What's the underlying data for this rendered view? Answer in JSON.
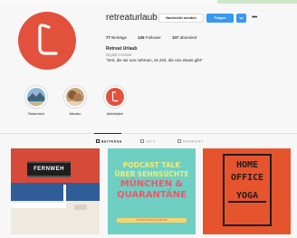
{
  "profile": {
    "username": "retreaturlaub",
    "message_label": "Nachricht senden",
    "follow_label": "Folgen",
    "stats": [
      {
        "value": "77",
        "label": "Beiträge"
      },
      {
        "value": "125",
        "label": "Follower"
      },
      {
        "value": "107",
        "label": "abonniert"
      }
    ],
    "full_name": "Retreat Urlaub",
    "category": "Digital Creator",
    "bio": "\"Zeit, die wir uns nehmen, ist Zeit, die uns etwas gibt\""
  },
  "highlights": [
    {
      "label": "Österreich",
      "icon": "mountain-lake-photo"
    },
    {
      "label": "Mexiko",
      "icon": "beach-photo"
    },
    {
      "label": "Aktivitäten",
      "icon": "logo-icon"
    }
  ],
  "tabs": [
    {
      "label": "BEITRÄGE",
      "active": true
    },
    {
      "label": "IGTV",
      "active": false
    },
    {
      "label": "MARKIERT",
      "active": false
    }
  ],
  "posts": [
    {
      "sign_text": "FERNWEH"
    },
    {
      "line1": "PODCAST TALK",
      "line2": "ÜBER SEHNSÜCHTE",
      "line3": "MÜNCHEN &",
      "line4": "QUARANTÄNE",
      "band": "retreat urlaub-podcast"
    },
    {
      "line1": "HOME",
      "line2": "OFFICE",
      "line3": "YOGA"
    }
  ],
  "colors": {
    "brand_red": "#e2513c",
    "follow_blue": "#3897f0"
  }
}
